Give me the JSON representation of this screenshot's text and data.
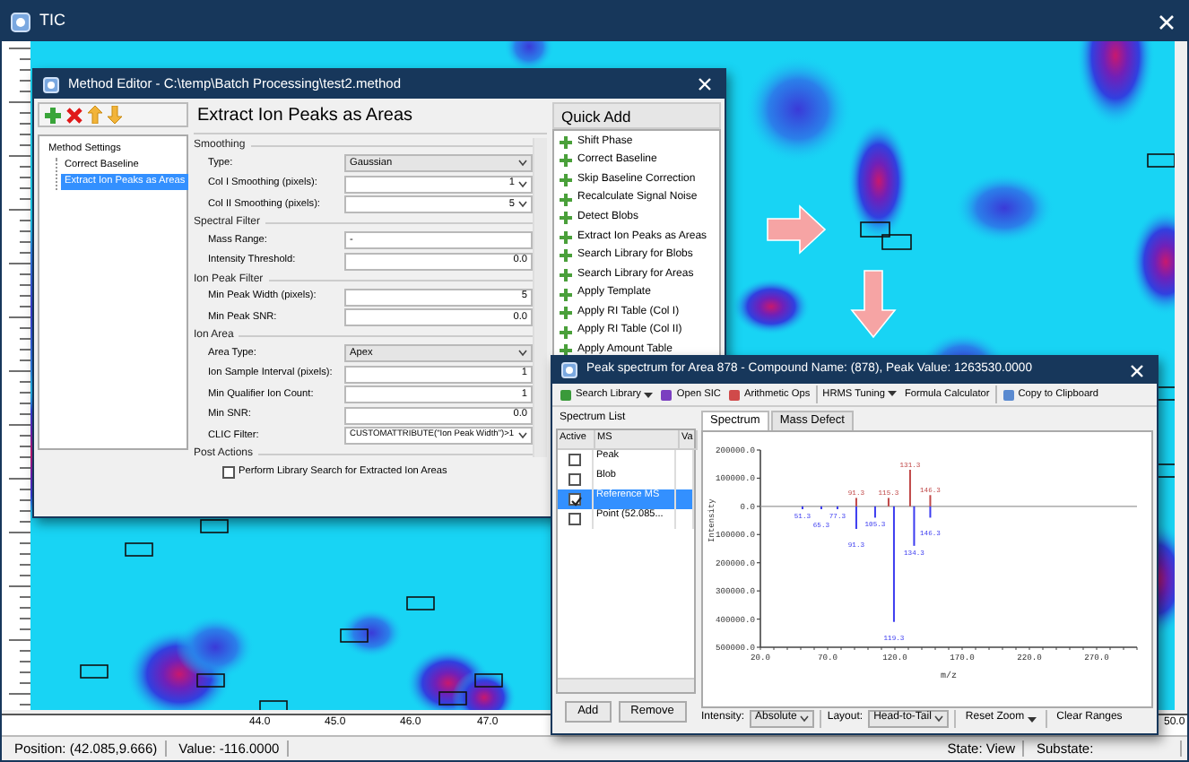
{
  "window": {
    "title": "TIC"
  },
  "plot": {
    "x_labels": [
      "44.0",
      "45.0",
      "46.0",
      "47.0",
      "50.0"
    ]
  },
  "status_bar": {
    "position": "Position: (42.085,9.666)",
    "value": "Value: -116.0000",
    "state": "State: View",
    "substate": "Substate:"
  },
  "method_editor": {
    "title": "Method Editor - C:\\temp\\Batch Processing\\test2.method",
    "tree": [
      {
        "label": "Method Settings",
        "selected": false,
        "children": [
          {
            "label": "Correct Baseline",
            "selected": false
          },
          {
            "label": "Extract Ion Peaks as Areas",
            "selected": true
          }
        ]
      }
    ],
    "heading": "Extract Ion Peaks as Areas",
    "sections": [
      {
        "title": "Smoothing",
        "fields": [
          {
            "kind": "select",
            "label": "Type:",
            "value": "Gaussian"
          },
          {
            "kind": "combo",
            "label": "Col I Smoothing (pixels):",
            "value": "1"
          },
          {
            "kind": "combo",
            "label": "Col II Smoothing (pixels):",
            "value": "5"
          }
        ]
      },
      {
        "title": "Spectral Filter",
        "fields": [
          {
            "kind": "text",
            "label": "Mass Range:",
            "value": "-"
          },
          {
            "kind": "number",
            "label": "Intensity Threshold:",
            "value": "0.0"
          }
        ]
      },
      {
        "title": "Ion Peak Filter",
        "fields": [
          {
            "kind": "number",
            "label": "Min Peak Width (pixels):",
            "value": "5"
          },
          {
            "kind": "number",
            "label": "Min Peak SNR:",
            "value": "0.0"
          }
        ]
      },
      {
        "title": "Ion Area",
        "fields": [
          {
            "kind": "select",
            "label": "Area Type:",
            "value": "Apex"
          },
          {
            "kind": "number",
            "label": "Ion Sample Interval (pixels):",
            "value": "1"
          },
          {
            "kind": "number",
            "label": "Min Qualifier Ion Count:",
            "value": "1"
          },
          {
            "kind": "number",
            "label": "Min SNR:",
            "value": "0.0"
          },
          {
            "kind": "editable",
            "label": "CLIC Filter:",
            "value": "CUSTOMATTRIBUTE(\"Ion Peak Width\")>1"
          }
        ]
      },
      {
        "title": "Post Actions",
        "fields": [
          {
            "kind": "checkbox",
            "label": "Perform Library Search for Extracted Ion Areas",
            "checked": false
          }
        ]
      }
    ],
    "quick_add": {
      "title": "Quick Add",
      "items": [
        "Shift Phase",
        "Correct Baseline",
        "Skip Baseline Correction",
        "Recalculate Signal Noise",
        "Detect Blobs",
        "Extract Ion Peaks as Areas",
        "Search Library for Blobs",
        "Search Library for Areas",
        "Apply Template",
        "Apply RI Table (Col I)",
        "Apply RI Table (Col II)",
        "Apply Amount Table"
      ]
    }
  },
  "spectrum_window": {
    "title": "Peak spectrum for Area 878 - Compound Name: (878), Peak Value: 1263530.0000",
    "toolbar": [
      {
        "label": "Search Library",
        "dropdown": true
      },
      {
        "label": "Open SIC",
        "dropdown": false
      },
      {
        "label": "Arithmetic Ops",
        "dropdown": false
      },
      {
        "label": "HRMS Tuning",
        "dropdown": true
      },
      {
        "label": "Formula Calculator",
        "dropdown": false
      },
      {
        "label": "Copy to Clipboard",
        "dropdown": false
      }
    ],
    "spectrum_list": {
      "title": "Spectrum List",
      "columns": [
        "Active",
        "MS",
        "Va"
      ],
      "rows": [
        {
          "ms": "Peak",
          "checked": false,
          "selected": false
        },
        {
          "ms": "Blob",
          "checked": false,
          "selected": false
        },
        {
          "ms": "Reference MS",
          "checked": true,
          "selected": true
        },
        {
          "ms": "Point (52.085...",
          "checked": false,
          "selected": false
        }
      ]
    },
    "buttons": [
      "Add",
      "Remove"
    ],
    "tabs": [
      {
        "label": "Spectrum",
        "selected": true
      },
      {
        "label": "Mass Defect",
        "selected": false
      }
    ],
    "chart_data": {
      "type": "bar",
      "xlabel": "m/z",
      "ylabel": "Intensity",
      "x": [
        51.3,
        65.3,
        77.3,
        91.3,
        105.3,
        115.3,
        119.3,
        131.3,
        134.3,
        146.3
      ],
      "series": [
        {
          "color": "#c04848",
          "values": [
            null,
            null,
            null,
            30000,
            null,
            30000,
            null,
            130000,
            null,
            40000
          ]
        },
        {
          "color": "#3c3cf0",
          "values": [
            -10000,
            -10000,
            -10000,
            -80000,
            -40000,
            null,
            -410000,
            null,
            -140000,
            -40000
          ]
        }
      ],
      "xlim": [
        20,
        300
      ],
      "ylim": [
        -500000,
        200000
      ],
      "xticks": [
        {
          "value": 20,
          "label": "20.0"
        },
        {
          "value": 70,
          "label": "70.0"
        },
        {
          "value": 120,
          "label": "120.0"
        },
        {
          "value": 170,
          "label": "170.0"
        },
        {
          "value": 220,
          "label": "220.0"
        },
        {
          "value": 270,
          "label": "270.0"
        }
      ],
      "yticks": [
        {
          "value": 200000,
          "label": "200000.0"
        },
        {
          "value": 100000,
          "label": "100000.0"
        },
        {
          "value": 0,
          "label": "0.0"
        },
        {
          "value": -100000,
          "label": "100000.0"
        },
        {
          "value": -200000,
          "label": "200000.0"
        },
        {
          "value": -300000,
          "label": "300000.0"
        },
        {
          "value": -400000,
          "label": "400000.0"
        },
        {
          "value": -500000,
          "label": "500000.0"
        }
      ],
      "value_labels": [
        [
          null,
          null,
          null,
          "91.3",
          null,
          "115.3",
          null,
          "131.3",
          null,
          "146.3"
        ],
        [
          "51.3",
          "65.3",
          "77.3",
          "91.3",
          "105.3",
          null,
          "119.3",
          null,
          "134.3",
          "146.3"
        ]
      ]
    },
    "bottom_bar": [
      {
        "kind": "label",
        "text": "Intensity:"
      },
      {
        "kind": "select",
        "text": "Absolute"
      },
      {
        "kind": "label",
        "text": "Layout:"
      },
      {
        "kind": "select",
        "text": "Head-to-Tail"
      },
      {
        "kind": "menu",
        "text": "Reset Zoom"
      },
      {
        "kind": "button",
        "text": "Clear Ranges"
      }
    ]
  }
}
